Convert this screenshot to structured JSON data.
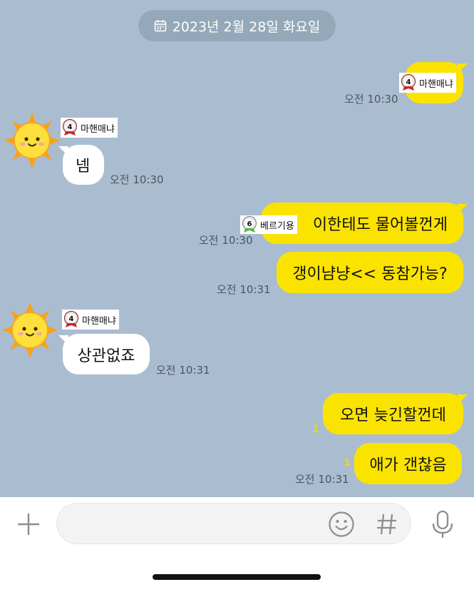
{
  "date_divider": "2023년 2월 28일 화요일",
  "messages": [
    {
      "sender": "me",
      "kind": "sticker",
      "sticker_label": "마핸매냐",
      "badge_number": "4",
      "time": "오전 10:30"
    },
    {
      "sender": "other",
      "kind": "sticker",
      "sticker_label": "마핸매냐",
      "badge_number": "4"
    },
    {
      "sender": "other",
      "kind": "text",
      "text": "넴",
      "time": "오전 10:30"
    },
    {
      "sender": "me",
      "kind": "text",
      "text": "이한테도 물어볼껀게",
      "overlay_sticker_label": "베르기용",
      "overlay_badge_number": "6",
      "time": "오전 10:30"
    },
    {
      "sender": "me",
      "kind": "text",
      "text": "갱이냠냥<< 동참가능?",
      "time": "오전 10:31"
    },
    {
      "sender": "other",
      "kind": "sticker",
      "sticker_label": "마핸매냐",
      "badge_number": "4"
    },
    {
      "sender": "other",
      "kind": "text",
      "text": "상관없죠",
      "time": "오전 10:31"
    },
    {
      "sender": "me",
      "kind": "text",
      "text": "오면 늦긴할껀데",
      "unread": "1"
    },
    {
      "sender": "me",
      "kind": "text",
      "text": "애가 갠찮음",
      "unread": "1",
      "time": "오전 10:31"
    }
  ],
  "input": {
    "value": "",
    "placeholder": ""
  },
  "icons": {
    "attach": "plus-icon",
    "emoji": "emoji-icon",
    "hashtag": "hashtag-icon",
    "voice": "microphone-icon",
    "date": "calendar-icon",
    "avatar": "sun-character-icon"
  },
  "colors": {
    "chat_background": "#aabdd0",
    "my_bubble": "#fbe300",
    "their_bubble": "#ffffff",
    "date_pill": "#94a8b9",
    "unread": "#f6d400"
  }
}
